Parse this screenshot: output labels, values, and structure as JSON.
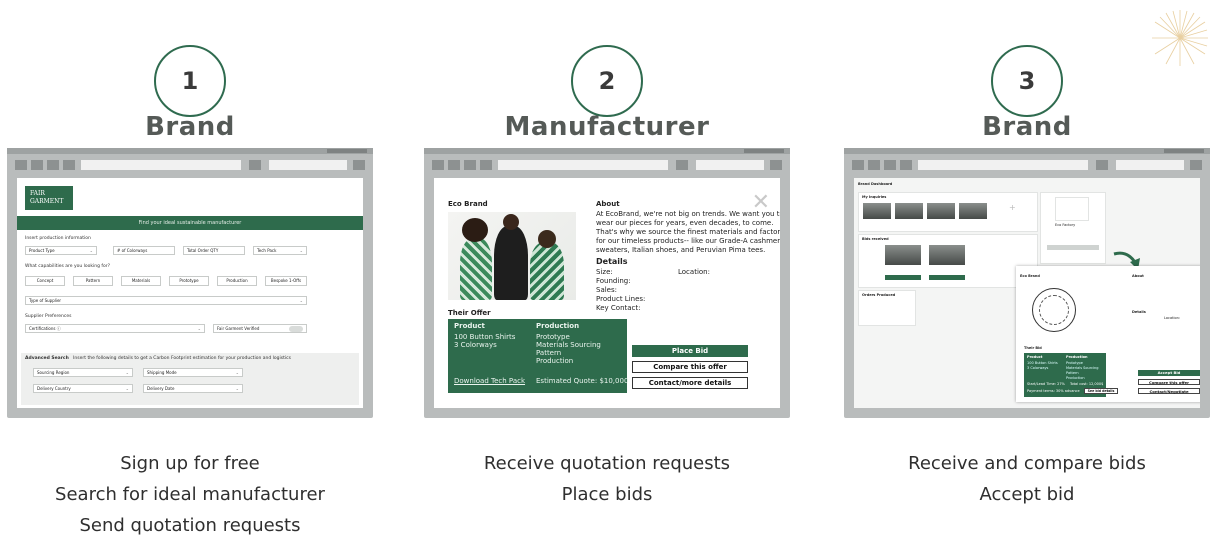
{
  "steps": [
    {
      "number": "1",
      "role": "Brand",
      "caption": [
        "Sign up for free",
        "Search for ideal manufacturer",
        "Send quotation requests"
      ],
      "screen": {
        "logo": "FAIR GARMENT",
        "banner": "Find your ideal sustainable manufacturer",
        "section_production": "Insert production information",
        "fields_row1": [
          "Product Type",
          "# of Colorways",
          "Total Order QTY",
          "Tech Pack"
        ],
        "capabilities_question": "What capabilities are you looking for?",
        "capabilities": [
          "Concept",
          "Pattern",
          "Materials",
          "Prototype",
          "Production",
          "Bespoke 1-Offs"
        ],
        "supplier_type": "Type of Supplier",
        "supplier_preferences": "Supplier Preferences",
        "certifications": "Certifications",
        "fair_garment_verified": "Fair Garment Verified",
        "advanced_search_title": "Advanced Search",
        "advanced_search_text": "Insert the following details to get a Carbon Footprint estimation for your production and logistics",
        "advanced_fields": [
          "Sourcing Region",
          "Shipping Mode",
          "Delivery Country",
          "Delivery Date"
        ]
      }
    },
    {
      "number": "2",
      "role": "Manufacturer",
      "caption": [
        "Receive quotation requests",
        "Place bids"
      ],
      "screen": {
        "brand_name": "Eco Brand",
        "about_title": "About",
        "about_text": [
          "At EcoBrand, we're not big on trends. We want you to",
          "wear our pieces for years, even decades, to come.",
          "That's why we source the finest materials and factories",
          "for our timeless products-- like our Grade-A cashmere",
          "sweaters, Italian shoes, and Peruvian Pima tees."
        ],
        "details_title": "Details",
        "details": [
          "Size:",
          "Founding:",
          "Sales:",
          "Product Lines:",
          "Key Contact:"
        ],
        "location_label": "Location:",
        "offer_title": "Their Offer",
        "product_header": "Product",
        "product_lines": [
          "100 Button Shirts",
          "3 Colorways"
        ],
        "production_header": "Production",
        "production_lines": [
          "Prototype",
          "Materials Sourcing",
          "Pattern",
          "Production"
        ],
        "download_link": "Download Tech Pack",
        "estimated_quote": "Estimated Quote: $10,000",
        "buttons": [
          "Place Bid",
          "Compare this offer",
          "Contact/more details"
        ]
      }
    },
    {
      "number": "3",
      "role": "Brand",
      "caption": [
        "Receive and compare bids",
        "Accept bid"
      ],
      "screen": {
        "dashboard_title": "Brand Dashboard",
        "my_inquiries": "My Inquiries",
        "bids_received": "Bids received",
        "orders_placed": "Orders Produced",
        "profile_name": "Eco Factory",
        "modal_brand": "Eco Brand",
        "about_title": "About",
        "details_title": "Details",
        "location_label": "Location:",
        "their_bid": "Their Bid",
        "product_header": "Product",
        "production_header": "Production",
        "product_lines": [
          "100 Button Shirts",
          "3 Colorways"
        ],
        "production_lines": [
          "Prototype",
          "Materials Sourcing",
          "Pattern",
          "Production"
        ],
        "start_date": "Start/Lead Time: 27%",
        "total_cost": "Total cost: 12,000$",
        "payment_terms": "Payment terms: 30% advance",
        "see_bid": "See bid details",
        "buttons": [
          "Accept Bid",
          "Compare this offer",
          "Contact/Negotiate"
        ]
      }
    }
  ]
}
